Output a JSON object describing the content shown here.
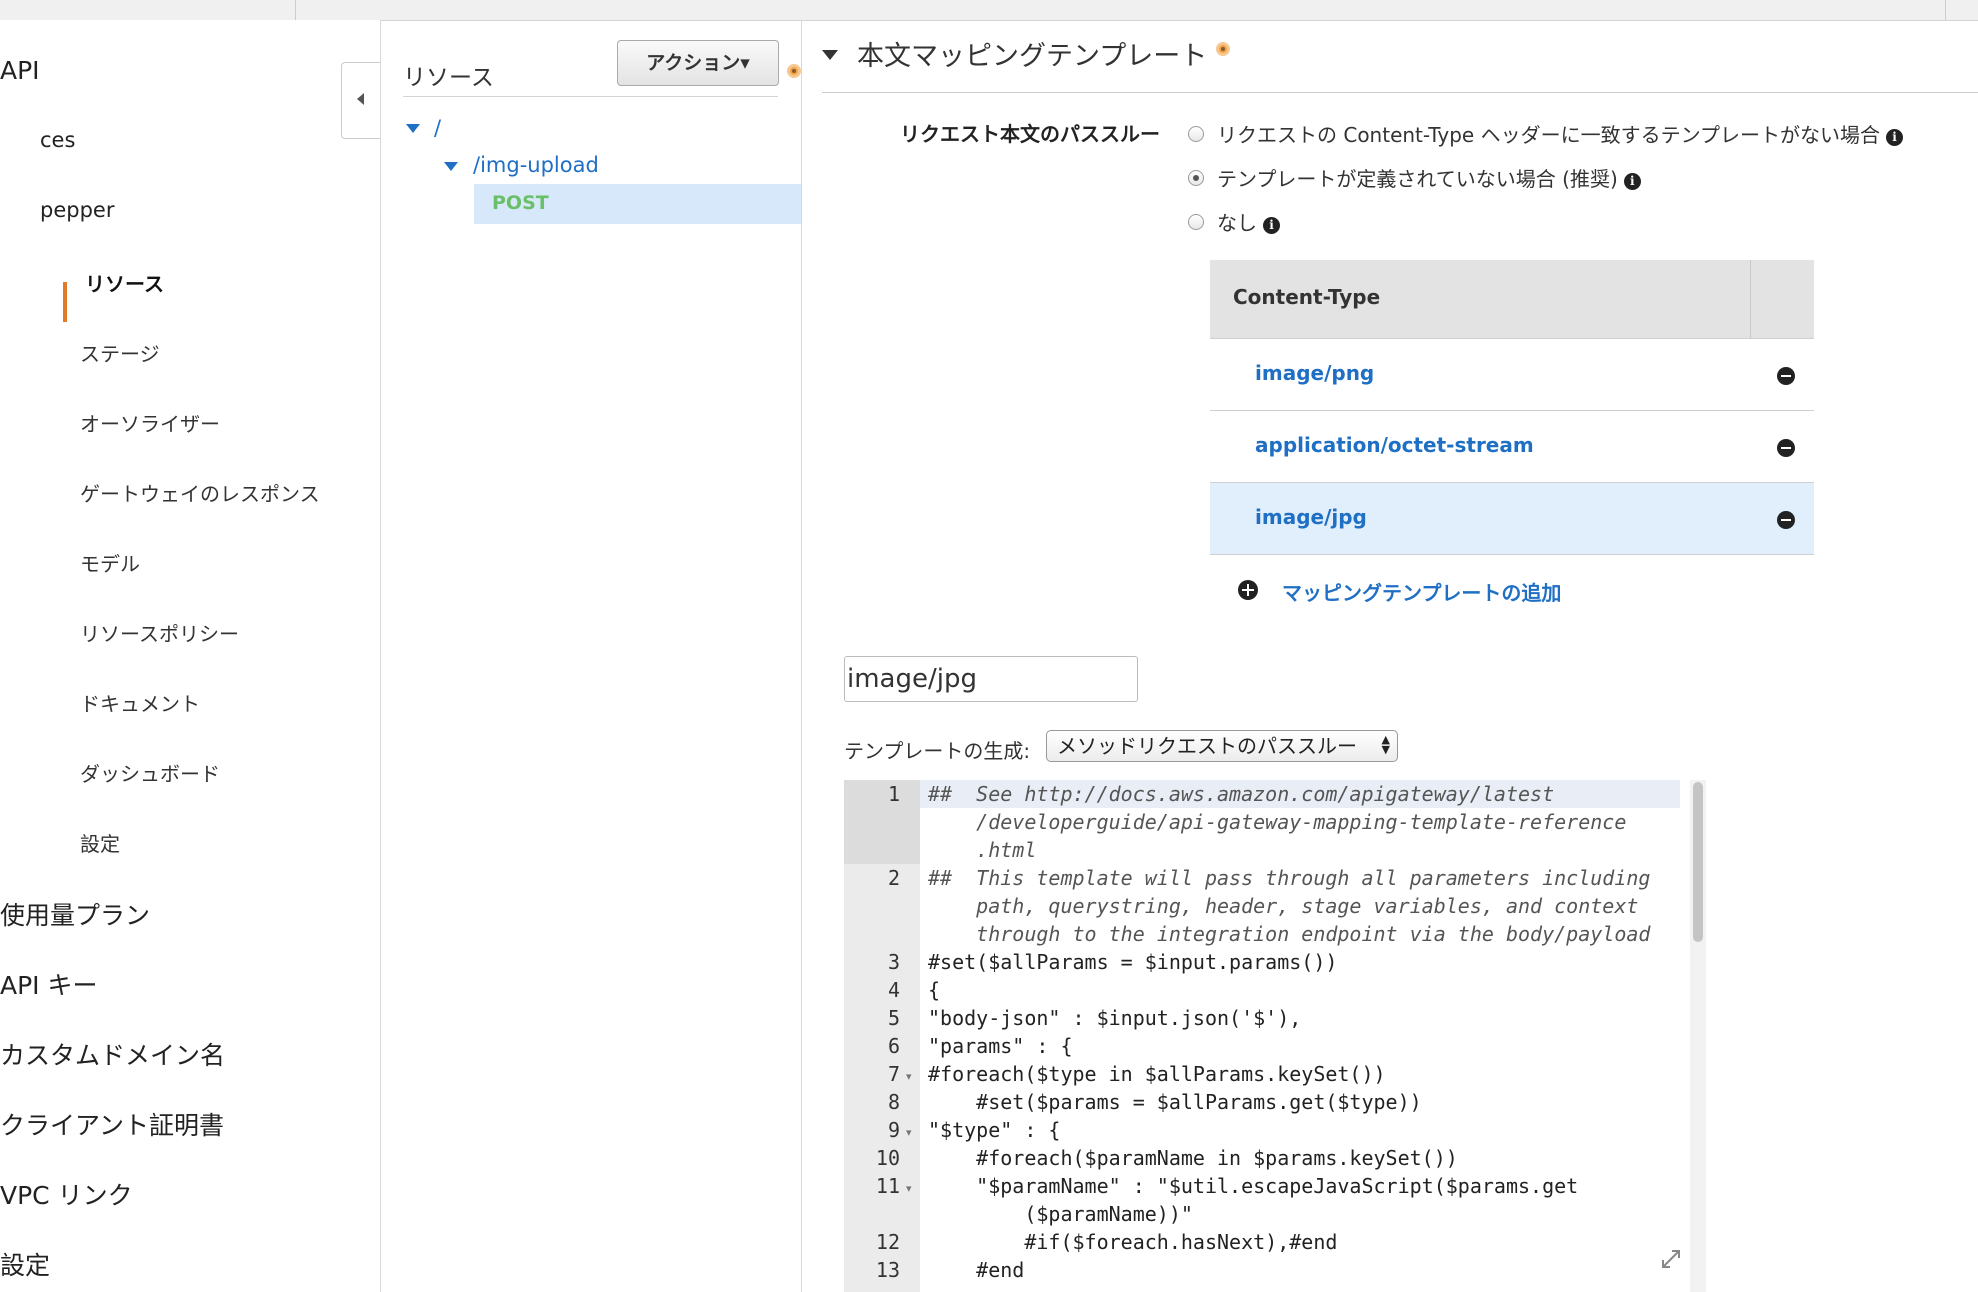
{
  "left_nav": {
    "api_label": "API",
    "apis": [
      "ces",
      "pepper"
    ],
    "sub_items": [
      "リソース",
      "ステージ",
      "オーソライザー",
      "ゲートウェイのレスポンス",
      "モデル",
      "リソースポリシー",
      "ドキュメント",
      "ダッシュボード",
      "設定"
    ],
    "active_item": "リソース",
    "top_items": [
      "使用量プラン",
      "API キー",
      "カスタムドメイン名",
      "クライアント証明書",
      "VPC リンク",
      "設定"
    ]
  },
  "resources": {
    "title": "リソース",
    "action_button": "アクション▾",
    "tree": {
      "root": "/",
      "child": "/img-upload",
      "method": "POST"
    }
  },
  "mapping": {
    "section_title": "本文マッピングテンプレート",
    "passthrough_label": "リクエスト本文のパススルー",
    "options": [
      {
        "label": "リクエストの Content-Type ヘッダーに一致するテンプレートがない場合",
        "selected": false
      },
      {
        "label": "テンプレートが定義されていない場合 (推奨)",
        "selected": true
      },
      {
        "label": "なし",
        "selected": false
      }
    ],
    "table_header": "Content-Type",
    "content_types": [
      {
        "name": "image/png",
        "selected": false
      },
      {
        "name": "application/octet-stream",
        "selected": false
      },
      {
        "name": "image/jpg",
        "selected": true
      }
    ],
    "add_link": "マッピングテンプレートの追加",
    "content_type_input": "image/jpg",
    "generate_label": "テンプレートの生成:",
    "generate_select": "メソッドリクエストのパススルー"
  },
  "editor": {
    "line_numbers": [
      "1",
      "2",
      "3",
      "4",
      "5",
      "6",
      "7",
      "8",
      "9",
      "10",
      "11",
      "12",
      "13"
    ],
    "lines": [
      "##  See http://docs.aws.amazon.com/apigateway/latest",
      "    /developerguide/api-gateway-mapping-template-reference",
      "    .html",
      "##  This template will pass through all parameters including",
      "    path, querystring, header, stage variables, and context",
      "    through to the integration endpoint via the body/payload",
      "#set($allParams = $input.params())",
      "{",
      "\"body-json\" : $input.json('$'),",
      "\"params\" : {",
      "#foreach($type in $allParams.keySet())",
      "    #set($params = $allParams.get($type))",
      "\"$type\" : {",
      "    #foreach($paramName in $params.keySet())",
      "    \"$paramName\" : \"$util.escapeJavaScript($params.get",
      "        ($paramName))\"",
      "        #if($foreach.hasNext),#end",
      "    #end"
    ]
  }
}
